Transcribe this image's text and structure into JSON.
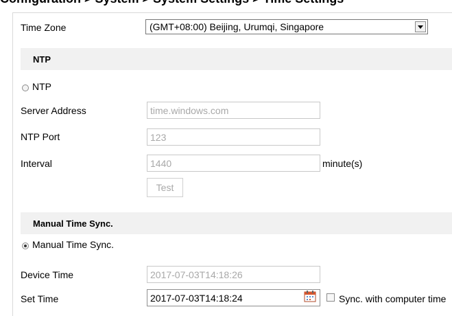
{
  "page_title": "Configuration > System > System Settings > Time Settings",
  "timezone": {
    "label": "Time Zone",
    "value": "(GMT+08:00) Beijing, Urumqi, Singapore"
  },
  "ntp_section": {
    "title": "NTP",
    "radio_label": "NTP",
    "selected": false,
    "server_address": {
      "label": "Server Address",
      "value": "time.windows.com"
    },
    "ntp_port": {
      "label": "NTP Port",
      "value": "123"
    },
    "interval": {
      "label": "Interval",
      "value": "1440",
      "unit": "minute(s)"
    },
    "test_button": "Test"
  },
  "manual_section": {
    "title": "Manual Time Sync.",
    "radio_label": "Manual Time Sync.",
    "selected": true,
    "device_time": {
      "label": "Device Time",
      "value": "2017-07-03T14:18:26"
    },
    "set_time": {
      "label": "Set Time",
      "value": "2017-07-03T14:18:24"
    },
    "sync_checkbox_label": "Sync. with computer time",
    "sync_checked": false
  }
}
